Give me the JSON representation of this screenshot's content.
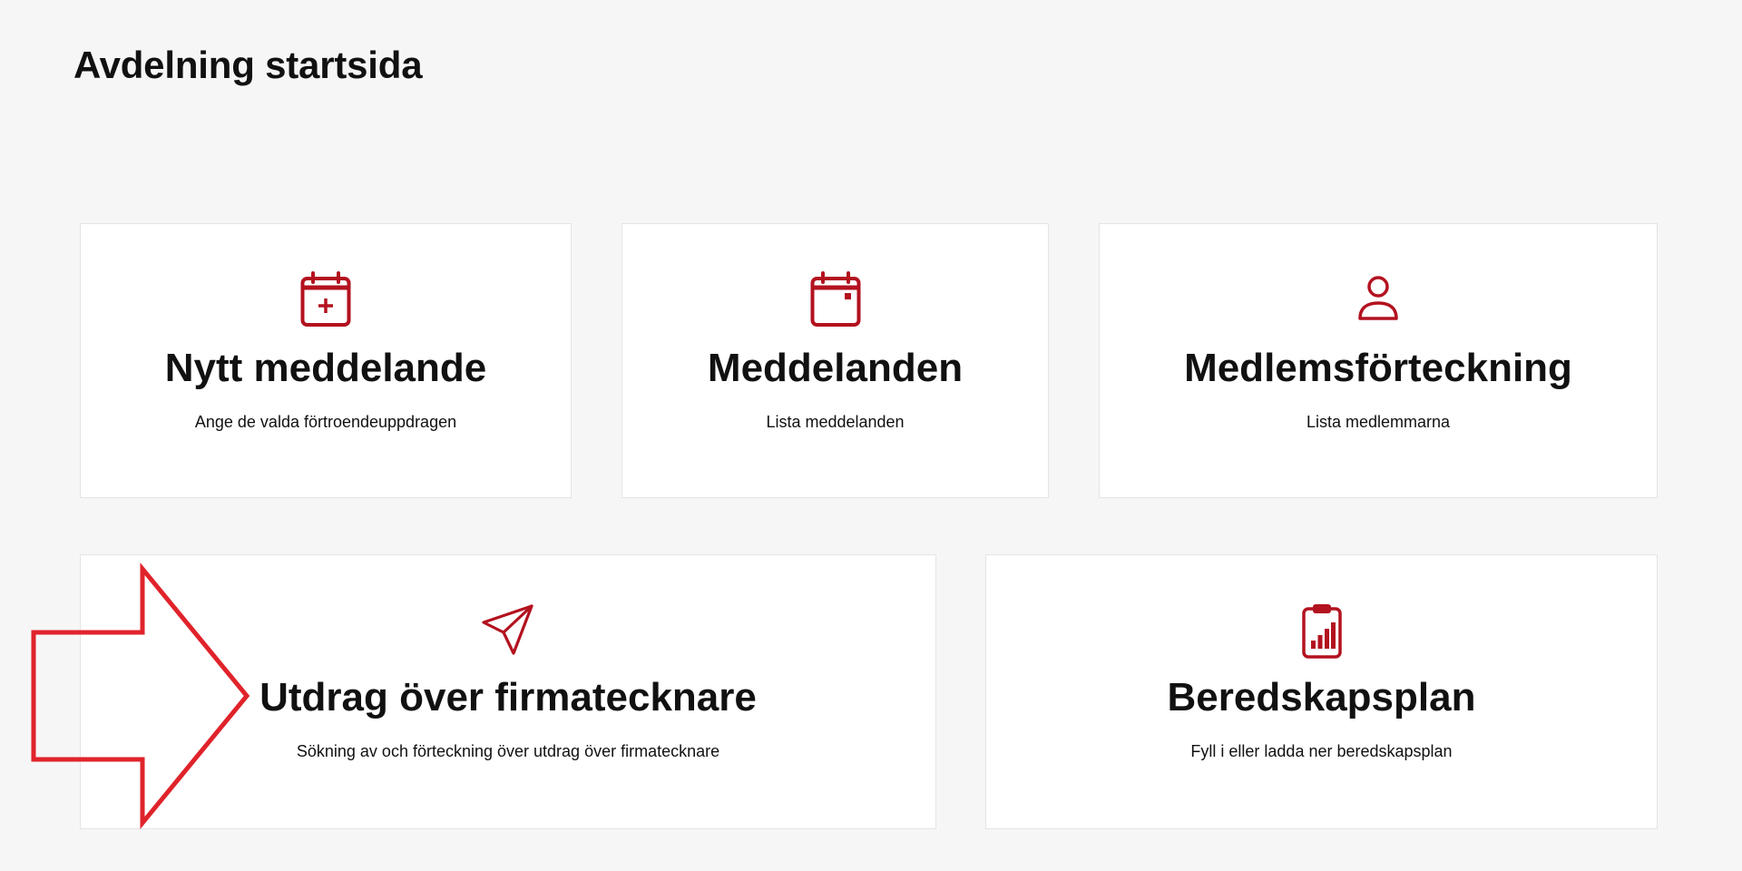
{
  "page": {
    "title": "Avdelning startsida"
  },
  "theme": {
    "accent": "#b3121f",
    "background": "#f6f6f6",
    "card_background": "#ffffff",
    "annotation_arrow": "#e0232b"
  },
  "cards": [
    {
      "title": "Nytt meddelande",
      "description": "Ange de valda förtroendeuppdragen",
      "icon": "calendar-plus-icon"
    },
    {
      "title": "Meddelanden",
      "description": "Lista meddelanden",
      "icon": "calendar-icon"
    },
    {
      "title": "Medlemsförteckning",
      "description": "Lista medlemmarna",
      "icon": "user-icon"
    },
    {
      "title": "Utdrag över firmatecknare",
      "description": "Sökning av och förteckning över utdrag över firmatecknare",
      "icon": "paper-plane-icon"
    },
    {
      "title": "Beredskapsplan",
      "description": "Fyll i eller ladda ner beredskapsplan",
      "icon": "clipboard-chart-icon"
    }
  ]
}
